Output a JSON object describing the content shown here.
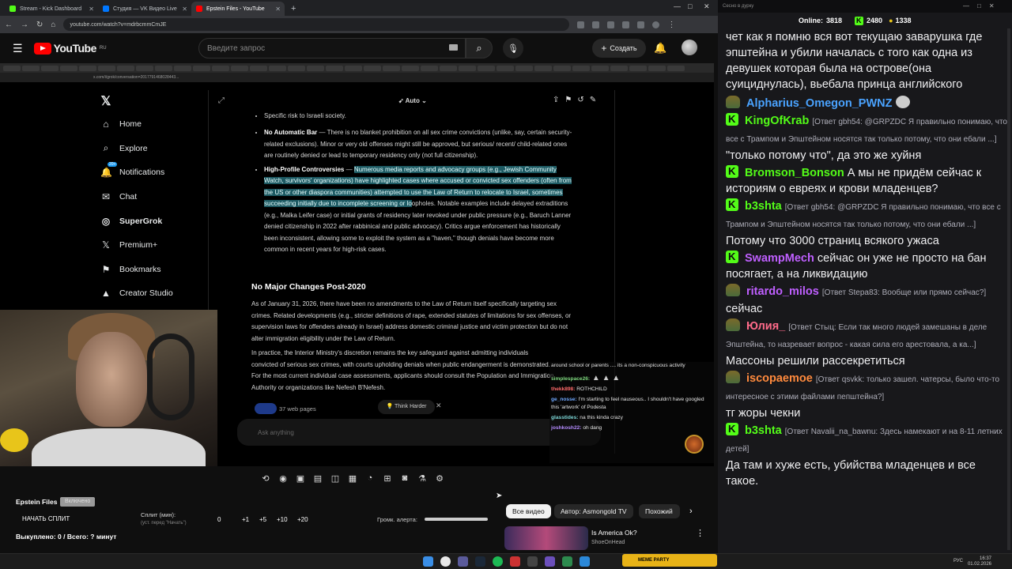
{
  "browser": {
    "tabs": [
      {
        "title": "Stream - Kick Dashboard",
        "color": "#53fc18"
      },
      {
        "title": "Студия — VK Видео Live",
        "color": "#0077ff"
      },
      {
        "title": "Epstein Files - YouTube",
        "color": "#ff0000",
        "active": true
      }
    ],
    "new_tab": "+",
    "url": "youtube.com/watch?v=mdrbcmmCmJE",
    "window_controls": [
      "—",
      "□",
      "✕"
    ]
  },
  "youtube": {
    "logo_text": "YouTube",
    "logo_region": "RU",
    "search_placeholder": "Введите запрос",
    "create_label": "Создать"
  },
  "video": {
    "inner_url": "x.com/i/grok/conversation=2017791468028443...",
    "x_sidebar": [
      {
        "icon": "home-icon",
        "label": "Home"
      },
      {
        "icon": "search-icon",
        "label": "Explore"
      },
      {
        "icon": "bell-icon",
        "label": "Notifications",
        "badge": "20+"
      },
      {
        "icon": "mail-icon",
        "label": "Chat"
      },
      {
        "icon": "grok-icon",
        "label": "SuperGrok"
      },
      {
        "icon": "x-icon",
        "label": "Premium+"
      },
      {
        "icon": "bookmark-icon",
        "label": "Bookmarks"
      },
      {
        "icon": "studio-icon",
        "label": "Creator Studio"
      }
    ],
    "mode_label": "Auto",
    "bullet_risk": "Specific risk to Israeli society.",
    "bullet_no_bar_title": "No Automatic Bar",
    "bullet_no_bar_text": " — There is no blanket prohibition on all sex crime convictions (unlike, say, certain security-related exclusions). Minor or very old offenses might still be approved, but serious/ recent/ child-related ones are routinely denied or lead to temporary residency only (not full citizenship).",
    "bullet_hp_title": "High-Profile Controversies",
    "bullet_hp_highlight": "Numerous media reports and advocacy groups (e.g., Jewish Community Watch, survivors' organizations) have highlighted cases where accused or convicted sex offenders (often from the US or other diaspora communities) attempted to use the Law of Return to relocate to Israel, sometimes succeeding initially due to incomplete screening or lo",
    "bullet_hp_rest": "opholes. Notable examples include delayed extraditions (e.g., Malka Leifer case) or initial grants of residency later revoked under public pressure (e.g., Baruch Lanner denied citizenship in 2022 after rabbinical and public advocacy). Critics argue enforcement has historically been inconsistent, allowing some to exploit the system as a \"haven,\" though denials have become more common in recent years for high-risk cases.",
    "heading": "No Major Changes Post-2020",
    "para1": "As of January 31, 2026, there have been no amendments to the Law of Return itself specifically targeting sex crimes. Related developments (e.g., stricter definitions of rape, extended statutes of limitations for sex offenses, or supervision laws for offenders already in Israel) address domestic criminal justice and victim protection but do not alter immigration eligibility under the Law of Return.",
    "para2": "In practice, the Interior Ministry's discretion remains the key safeguard against admitting individuals convicted of serious sex crimes, with courts upholding denials when public endangerment is demonstrated. For the most current individual case assessments, applicants should consult the Population and Immigration Authority or organizations like Nefesh B'Nefesh.",
    "web_pages": "37 web pages",
    "think_harder": "Think Harder",
    "ask_placeholder": "Ask anything",
    "overlay_chat": [
      {
        "user": "",
        "text": "around school or parents .... its a non-conspicuous activity",
        "color": "#e6e6e6"
      },
      {
        "user": "simplespace26:",
        "text": " ▲ ▲ ▲",
        "color": "#7fd97f"
      },
      {
        "user": "thekk898:",
        "text": " ROTHCHILD",
        "color": "#ff6b6b"
      },
      {
        "user": "ge_nosse:",
        "text": " I'm starting to feel nauseous.. I shouldn't have googled this 'artwork' of Podesta",
        "color": "#6fa8ff"
      },
      {
        "user": "glasstides:",
        "text": " na this kinda crazy",
        "color": "#7fd9d9"
      },
      {
        "user": "joshkosh22:",
        "text": " oh dang",
        "color": "#b58cff"
      }
    ]
  },
  "bottom_panel": {
    "title": "Epstein Files",
    "badge": "Включено",
    "start_split": "НАЧАТЬ СПЛИТ",
    "split_label": "Сплит (мин):",
    "split_sub": "(уст. перед \"Начать\")",
    "split_values": [
      "0",
      "+1",
      "+5",
      "+10",
      "+20"
    ],
    "volume_label": "Громк. алерта:",
    "bought": "Выкуплено: 0 / Всего: ? минут"
  },
  "chips": [
    "Все видео",
    "Автор: Asmongold TV",
    "Похожий"
  ],
  "recommended": {
    "title": "Is America Ok?",
    "channel": "ShoeOnHead"
  },
  "chat": {
    "header": "Сесно в дурку",
    "online_label": "Online:",
    "online_value": "3818",
    "count1": "2480",
    "count2": "1338",
    "messages": [
      {
        "name": "",
        "badge": "",
        "reply": "",
        "text": "чет как я помню вся вот текущаю заварушка где эпштейна и убили началась с того как одна из девушек которая была на острове(она суициднулась), вьебала принца английского",
        "name_color": "#efeff1"
      },
      {
        "name": "Alpharius_Omegon_PWNZ",
        "badge": "emote",
        "reply": "",
        "text": "",
        "name_color": "#4aa3ff"
      },
      {
        "name": "KingOfKrab",
        "badge": "kick",
        "reply": "[Ответ gbh54: @GRPZDC Я правильно понимаю, что все с Трампом и Эпштейном носятся так только потому, что они ебали ...]",
        "text": "\"только потому что\", да это же хуйня",
        "name_color": "#53fc18"
      },
      {
        "name": "Bromson_Bonson",
        "badge": "kick",
        "reply": "",
        "text": "А мы не придём сейчас к историям о евреях и крови младенцев?",
        "name_color": "#53fc18"
      },
      {
        "name": "b3shta",
        "badge": "kick",
        "reply": "[Ответ gbh54: @GRPZDC Я правильно понимаю, что все с Трампом и Эпштейном носятся так только потому, что они ебали ...]",
        "text": "Потому что 3000 страниц всякого ужаса",
        "name_color": "#53fc18"
      },
      {
        "name": "SwampMech",
        "badge": "kick",
        "reply": "",
        "text": "сейчас он уже не просто на бан посягает, а на ликвидацию",
        "name_color": "#bf5fff"
      },
      {
        "name": "ritardo_milos",
        "badge": "emote",
        "reply": "[Ответ Stepa83: Вообще или прямо сейчас?]",
        "text": "сейчас",
        "name_color": "#bf5fff"
      },
      {
        "name": "Юлия_",
        "badge": "emote",
        "reply": "[Ответ Стыц: Если так много людей замешаны в деле Эпштейна, то назревает вопрос - какая сила его арестовала, а ка...]",
        "text": "Массоны решили рассекретиться",
        "name_color": "#ff6b8a"
      },
      {
        "name": "iscopaemoe",
        "badge": "emote",
        "reply": "[Ответ qsvkk: только зашел. чатерсы, было что-то интересное с этими файлами пепштейна?]",
        "text": "тг жоры чекни",
        "name_color": "#ff8a3d"
      },
      {
        "name": "b3shta",
        "badge": "kick",
        "reply": "[Ответ Navalii_na_bawnu: Здесь намекают и на 8-11 летних детей]",
        "text": "Да там и хуже есть, убийства младенцев и все такое.",
        "name_color": "#53fc18"
      }
    ]
  },
  "taskbar": {
    "lang": "РУС",
    "time": "16:37",
    "date": "01.02.2026",
    "gamebar_label": "MEME PARTY"
  }
}
